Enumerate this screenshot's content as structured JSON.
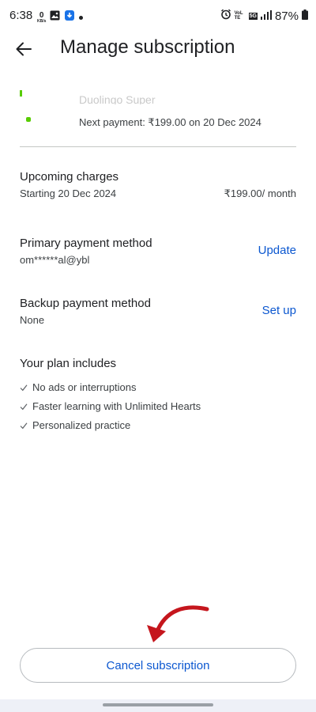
{
  "status_bar": {
    "time": "6:38",
    "data_speed": "0",
    "data_unit": "KB/s",
    "network_volte": "VoLTE",
    "network_5g": "5G",
    "battery": "87%"
  },
  "header": {
    "title": "Manage subscription"
  },
  "subscription": {
    "title": "Duolingo Super",
    "next_payment": "Next payment: ₹199.00 on 20 Dec 2024"
  },
  "upcoming_charges": {
    "title": "Upcoming charges",
    "start": "Starting 20 Dec 2024",
    "amount": "₹199.00/ month"
  },
  "primary_payment": {
    "title": "Primary payment method",
    "value": "om******al@ybl",
    "action": "Update"
  },
  "backup_payment": {
    "title": "Backup payment method",
    "value": "None",
    "action": "Set up"
  },
  "plan": {
    "title": "Your plan includes",
    "features": [
      "No ads or interruptions",
      "Faster learning with Unlimited Hearts",
      "Personalized practice"
    ]
  },
  "cancel_label": "Cancel subscription",
  "colors": {
    "accent": "#0b57d0",
    "annotation": "#c5161d",
    "app_green": "#58cc02"
  }
}
